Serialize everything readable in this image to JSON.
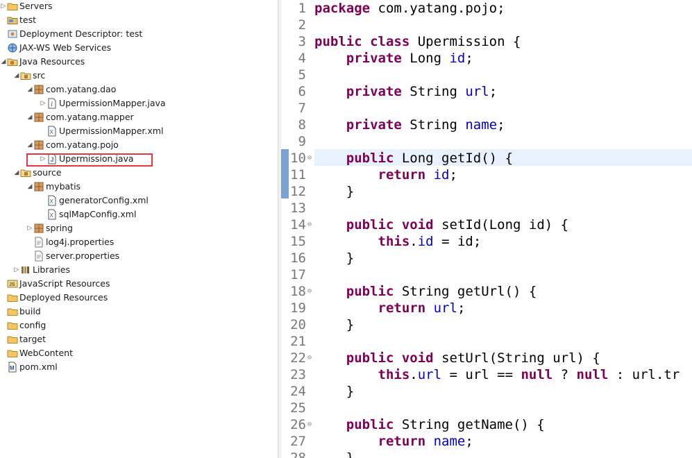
{
  "explorer": {
    "items": [
      {
        "label": "Servers",
        "icon": "folder-icon",
        "depth": 0,
        "expander": "collapsed"
      },
      {
        "label": "test",
        "icon": "project-icon",
        "depth": 0,
        "expander": "none"
      },
      {
        "label": "Deployment Descriptor: test",
        "icon": "deployment-descriptor-icon",
        "depth": 0,
        "expander": "none"
      },
      {
        "label": "JAX-WS Web Services",
        "icon": "web-services-icon",
        "depth": 0,
        "expander": "none"
      },
      {
        "label": "Java Resources",
        "icon": "java-resources-icon",
        "depth": 0,
        "expander": "expanded"
      },
      {
        "label": "src",
        "icon": "source-folder-icon",
        "depth": 1,
        "expander": "expanded"
      },
      {
        "label": "com.yatang.dao",
        "icon": "package-icon",
        "depth": 2,
        "expander": "expanded"
      },
      {
        "label": "UpermissionMapper.java",
        "icon": "java-interface-file-icon",
        "depth": 3,
        "expander": "collapsed"
      },
      {
        "label": "com.yatang.mapper",
        "icon": "package-icon",
        "depth": 2,
        "expander": "expanded"
      },
      {
        "label": "UpermissionMapper.xml",
        "icon": "xml-file-icon",
        "depth": 3,
        "expander": "none"
      },
      {
        "label": "com.yatang.pojo",
        "icon": "package-icon",
        "depth": 2,
        "expander": "expanded"
      },
      {
        "label": "Upermission.java",
        "icon": "java-file-icon",
        "depth": 3,
        "expander": "collapsed",
        "selected": true
      },
      {
        "label": "source",
        "icon": "source-folder-icon",
        "depth": 1,
        "expander": "expanded"
      },
      {
        "label": "mybatis",
        "icon": "package-icon",
        "depth": 2,
        "expander": "expanded"
      },
      {
        "label": "generatorConfig.xml",
        "icon": "xml-file-icon",
        "depth": 3,
        "expander": "none"
      },
      {
        "label": "sqlMapConfig.xml",
        "icon": "xml-file-icon",
        "depth": 3,
        "expander": "none"
      },
      {
        "label": "spring",
        "icon": "package-icon",
        "depth": 2,
        "expander": "collapsed"
      },
      {
        "label": "log4j.properties",
        "icon": "properties-file-icon",
        "depth": 2,
        "expander": "none"
      },
      {
        "label": "server.properties",
        "icon": "properties-file-icon",
        "depth": 2,
        "expander": "none"
      },
      {
        "label": "Libraries",
        "icon": "libraries-icon",
        "depth": 1,
        "expander": "collapsed"
      },
      {
        "label": "JavaScript Resources",
        "icon": "javascript-resources-icon",
        "depth": 0,
        "expander": "none"
      },
      {
        "label": "Deployed Resources",
        "icon": "folder-icon",
        "depth": 0,
        "expander": "none"
      },
      {
        "label": "build",
        "icon": "folder-icon",
        "depth": 0,
        "expander": "none"
      },
      {
        "label": "config",
        "icon": "folder-icon",
        "depth": 0,
        "expander": "none"
      },
      {
        "label": "target",
        "icon": "folder-icon",
        "depth": 0,
        "expander": "none"
      },
      {
        "label": "WebContent",
        "icon": "folder-icon",
        "depth": 0,
        "expander": "none"
      },
      {
        "label": "pom.xml",
        "icon": "maven-pom-icon",
        "depth": 0,
        "expander": "none"
      }
    ]
  },
  "editor": {
    "current_line": 10,
    "lines": [
      {
        "n": "1",
        "fold": "",
        "tokens": [
          [
            "k",
            "package"
          ],
          [
            "p",
            " com.yatang.pojo;"
          ]
        ]
      },
      {
        "n": "2",
        "fold": "",
        "tokens": []
      },
      {
        "n": "3",
        "fold": "",
        "tokens": [
          [
            "k",
            "public"
          ],
          [
            "p",
            " "
          ],
          [
            "k",
            "class"
          ],
          [
            "p",
            " Upermission {"
          ]
        ]
      },
      {
        "n": "4",
        "fold": "",
        "tokens": [
          [
            "p",
            "    "
          ],
          [
            "k",
            "private"
          ],
          [
            "p",
            " Long "
          ],
          [
            "f",
            "id"
          ],
          [
            "p",
            ";"
          ]
        ]
      },
      {
        "n": "5",
        "fold": "",
        "tokens": []
      },
      {
        "n": "6",
        "fold": "",
        "tokens": [
          [
            "p",
            "    "
          ],
          [
            "k",
            "private"
          ],
          [
            "p",
            " String "
          ],
          [
            "f",
            "url"
          ],
          [
            "p",
            ";"
          ]
        ]
      },
      {
        "n": "7",
        "fold": "",
        "tokens": []
      },
      {
        "n": "8",
        "fold": "",
        "tokens": [
          [
            "p",
            "    "
          ],
          [
            "k",
            "private"
          ],
          [
            "p",
            " String "
          ],
          [
            "f",
            "name"
          ],
          [
            "p",
            ";"
          ]
        ]
      },
      {
        "n": "9",
        "fold": "",
        "tokens": []
      },
      {
        "n": "10",
        "fold": "⊖",
        "tokens": [
          [
            "p",
            "    "
          ],
          [
            "k",
            "public"
          ],
          [
            "p",
            " Long getId() {"
          ]
        ]
      },
      {
        "n": "11",
        "fold": "",
        "tokens": [
          [
            "p",
            "        "
          ],
          [
            "k",
            "return"
          ],
          [
            "p",
            " "
          ],
          [
            "f",
            "id"
          ],
          [
            "p",
            ";"
          ]
        ]
      },
      {
        "n": "12",
        "fold": "",
        "tokens": [
          [
            "p",
            "    }"
          ]
        ]
      },
      {
        "n": "13",
        "fold": "",
        "tokens": []
      },
      {
        "n": "14",
        "fold": "⊖",
        "tokens": [
          [
            "p",
            "    "
          ],
          [
            "k",
            "public"
          ],
          [
            "p",
            " "
          ],
          [
            "k",
            "void"
          ],
          [
            "p",
            " setId(Long id) {"
          ]
        ]
      },
      {
        "n": "15",
        "fold": "",
        "tokens": [
          [
            "p",
            "        "
          ],
          [
            "k",
            "this"
          ],
          [
            "p",
            "."
          ],
          [
            "f",
            "id"
          ],
          [
            "p",
            " = id;"
          ]
        ]
      },
      {
        "n": "16",
        "fold": "",
        "tokens": [
          [
            "p",
            "    }"
          ]
        ]
      },
      {
        "n": "17",
        "fold": "",
        "tokens": []
      },
      {
        "n": "18",
        "fold": "⊖",
        "tokens": [
          [
            "p",
            "    "
          ],
          [
            "k",
            "public"
          ],
          [
            "p",
            " String getUrl() {"
          ]
        ]
      },
      {
        "n": "19",
        "fold": "",
        "tokens": [
          [
            "p",
            "        "
          ],
          [
            "k",
            "return"
          ],
          [
            "p",
            " "
          ],
          [
            "f",
            "url"
          ],
          [
            "p",
            ";"
          ]
        ]
      },
      {
        "n": "20",
        "fold": "",
        "tokens": [
          [
            "p",
            "    }"
          ]
        ]
      },
      {
        "n": "21",
        "fold": "",
        "tokens": []
      },
      {
        "n": "22",
        "fold": "⊖",
        "tokens": [
          [
            "p",
            "    "
          ],
          [
            "k",
            "public"
          ],
          [
            "p",
            " "
          ],
          [
            "k",
            "void"
          ],
          [
            "p",
            " setUrl(String url) {"
          ]
        ]
      },
      {
        "n": "23",
        "fold": "",
        "tokens": [
          [
            "p",
            "        "
          ],
          [
            "k",
            "this"
          ],
          [
            "p",
            "."
          ],
          [
            "f",
            "url"
          ],
          [
            "p",
            " = url == "
          ],
          [
            "k",
            "null"
          ],
          [
            "p",
            " ? "
          ],
          [
            "k",
            "null"
          ],
          [
            "p",
            " : url.tr"
          ]
        ]
      },
      {
        "n": "24",
        "fold": "",
        "tokens": [
          [
            "p",
            "    }"
          ]
        ]
      },
      {
        "n": "25",
        "fold": "",
        "tokens": []
      },
      {
        "n": "26",
        "fold": "⊖",
        "tokens": [
          [
            "p",
            "    "
          ],
          [
            "k",
            "public"
          ],
          [
            "p",
            " String getName() {"
          ]
        ]
      },
      {
        "n": "27",
        "fold": "",
        "tokens": [
          [
            "p",
            "        "
          ],
          [
            "k",
            "return"
          ],
          [
            "p",
            " "
          ],
          [
            "f",
            "name"
          ],
          [
            "p",
            ";"
          ]
        ]
      },
      {
        "n": "28",
        "fold": "",
        "tokens": [
          [
            "p",
            "    }"
          ]
        ]
      }
    ]
  },
  "colors": {
    "keyword": "#7f0055",
    "field": "#0000c0",
    "selection_outline": "#e8343c",
    "current_line": "#e8f2fe",
    "ruler_mark": "#4f81bd"
  }
}
